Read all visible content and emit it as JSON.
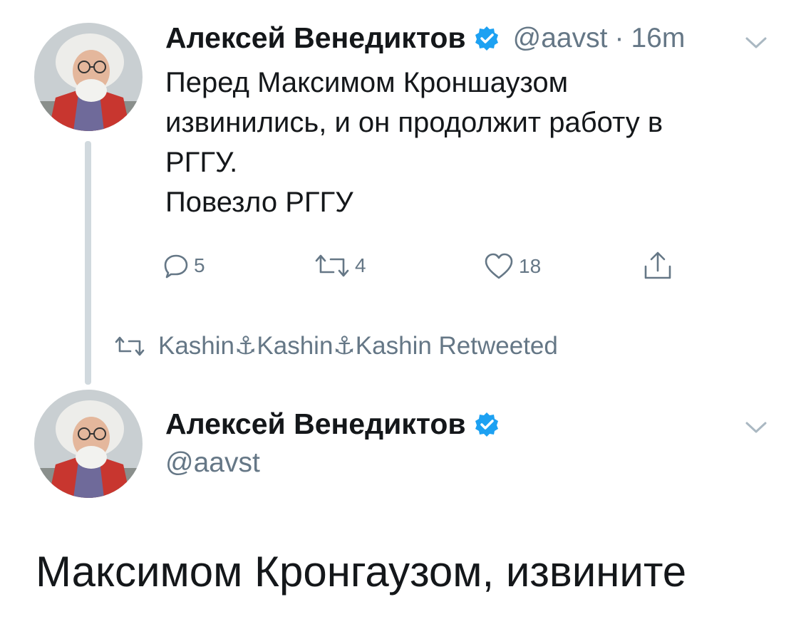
{
  "colors": {
    "text_primary": "#14171a",
    "text_secondary": "#657786",
    "verified_blue": "#1da1f2",
    "thread_line": "#d1d9de"
  },
  "tweet1": {
    "author_name": "Алексей Венедиктов",
    "handle": "@aavst",
    "separator": "·",
    "time": "16m",
    "text_lines": [
      "Перед Максимом Кроншаузом",
      "извинились, и он продолжит работу в",
      "РГГУ.",
      "Повезло РГГУ"
    ],
    "actions": {
      "replies": "5",
      "retweets": "4",
      "likes": "18"
    }
  },
  "retweet_banner": {
    "text": "Kashin⚓Kashin⚓Kashin Retweeted",
    "icon": "retweet-icon"
  },
  "tweet2": {
    "author_name": "Алексей Венедиктов",
    "handle": "@aavst"
  },
  "caption": {
    "text": "Максимом Кронгаузом, извините"
  }
}
